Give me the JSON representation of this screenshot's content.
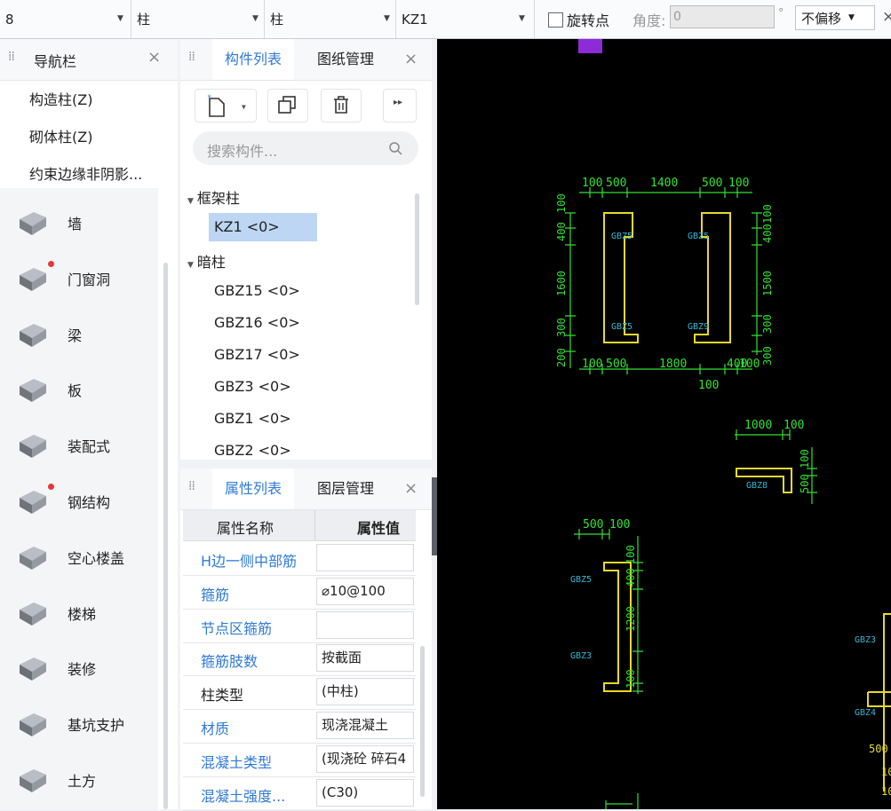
{
  "toolbar": {
    "floor_value": "8",
    "category_value": "柱",
    "subtype_value": "柱",
    "component_value": "KZ1",
    "rotate_point_label": "旋转点",
    "angle_label": "角度:",
    "angle_value": "0",
    "degree_symbol": "°",
    "offset_value": "不偏移",
    "close_glyph": "×"
  },
  "nav": {
    "title": "导航栏",
    "sub_items": [
      {
        "label": "构造柱(Z)"
      },
      {
        "label": "砌体柱(Z)"
      },
      {
        "label": "约束边缘非阴影..."
      }
    ],
    "items": [
      {
        "label": "墙",
        "icon": "wall-icon",
        "badge": false
      },
      {
        "label": "门窗洞",
        "icon": "door-window-icon",
        "badge": true
      },
      {
        "label": "梁",
        "icon": "beam-icon",
        "badge": false
      },
      {
        "label": "板",
        "icon": "slab-icon",
        "badge": false
      },
      {
        "label": "装配式",
        "icon": "prefab-icon",
        "badge": false
      },
      {
        "label": "钢结构",
        "icon": "steel-icon",
        "badge": true
      },
      {
        "label": "空心楼盖",
        "icon": "hollow-floor-icon",
        "badge": false
      },
      {
        "label": "楼梯",
        "icon": "stairs-icon",
        "badge": false
      },
      {
        "label": "装修",
        "icon": "decoration-icon",
        "badge": false
      },
      {
        "label": "基坑支护",
        "icon": "foundation-pit-icon",
        "badge": false
      },
      {
        "label": "土方",
        "icon": "earthwork-icon",
        "badge": false
      }
    ]
  },
  "components": {
    "tab_active": "构件列表",
    "tab_other": "图纸管理",
    "search_placeholder": "搜索构件...",
    "groups": [
      {
        "name": "框架柱",
        "items": [
          "KZ1 <0>"
        ]
      },
      {
        "name": "暗柱",
        "items": [
          "GBZ15 <0>",
          "GBZ16 <0>",
          "GBZ17 <0>",
          "GBZ3 <0>",
          "GBZ1 <0>",
          "GBZ2 <0>"
        ]
      }
    ]
  },
  "properties": {
    "tab_active": "属性列表",
    "tab_other": "图层管理",
    "col_name": "属性名称",
    "col_value": "属性值",
    "rows": [
      {
        "name": "H边一侧中部筋",
        "value": "",
        "blue": true
      },
      {
        "name": "箍筋",
        "value": "⌀10@100",
        "blue": true
      },
      {
        "name": "节点区箍筋",
        "value": "",
        "blue": true
      },
      {
        "name": "箍筋肢数",
        "value": "按截面",
        "blue": true
      },
      {
        "name": "柱类型",
        "value": "(中柱)",
        "blue": false
      },
      {
        "name": "材质",
        "value": "现浇混凝土",
        "blue": true
      },
      {
        "name": "混凝土类型",
        "value": "(现浇砼 碎石4",
        "blue": true
      },
      {
        "name": "混凝土强度...",
        "value": "(C30)",
        "blue": true
      }
    ]
  },
  "canvas": {
    "dims_top": [
      "100",
      "500",
      "1400",
      "500",
      "100"
    ],
    "dims_left": [
      "100",
      "400",
      "1600",
      "300",
      "200"
    ],
    "dims_right": [
      "100",
      "400",
      "1500",
      "300",
      "300"
    ],
    "dims_bottom": [
      "100",
      "500",
      "1800",
      "400",
      "100"
    ],
    "dim_bottom_total": "100",
    "labels_main": [
      "GBZ5",
      "GBZ5",
      "GBZ5",
      "GBZ9"
    ],
    "small_top": [
      "1000",
      "100"
    ],
    "small_right": [
      "100",
      "500"
    ],
    "small_label": "GBZ8",
    "left_top": [
      "500",
      "100"
    ],
    "left_right": [
      "100",
      "400",
      "1200",
      "100"
    ],
    "left_labels": [
      "GBZ5",
      "GBZ3"
    ],
    "edge_labels": [
      "GBZ3",
      "GBZ4",
      "500",
      "10",
      "10"
    ]
  }
}
